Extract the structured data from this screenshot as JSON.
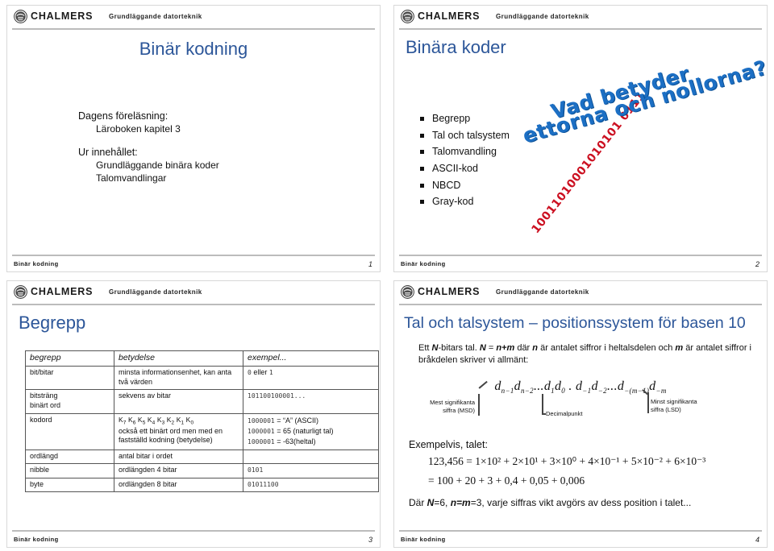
{
  "brand": {
    "name": "CHALMERS",
    "course": "Grundläggande datorteknik",
    "title_color": "#2c5699",
    "watermark_blue": "#1c6fc4",
    "watermark_red": "#cc1122"
  },
  "footer": {
    "label": "Binär kodning"
  },
  "slides": [
    {
      "number": "1",
      "title": "Binär kodning",
      "body": {
        "line1": "Dagens föreläsning:",
        "line2": "Läroboken kapitel 3",
        "line3": "Ur innehållet:",
        "line4": "Grundläggande binära koder",
        "line5": "Talomvandlingar"
      }
    },
    {
      "number": "2",
      "title": "Binära koder",
      "bullets": [
        "Begrepp",
        "Tal och talsystem",
        "Talomvandling",
        "ASCII-kod",
        "NBCD",
        "Gray-kod"
      ],
      "watermark": {
        "blue_line1": "Vad betyder",
        "blue_line2": "ettorna och nollorna?",
        "red_binary": "10011010001010101 0111"
      }
    },
    {
      "number": "3",
      "title": "Begrepp",
      "table": {
        "headers": [
          "begrepp",
          "betydelse",
          "exempel..."
        ],
        "rows": [
          {
            "begrepp": "bit/bitar",
            "betydelse": "minsta informationsenhet, kan anta två värden",
            "exempel_mono_a": "0",
            "exempel_plain": " eller ",
            "exempel_mono_b": "1"
          },
          {
            "begrepp": "bitsträng\nbinärt ord",
            "betydelse": "sekvens av bitar",
            "exempel_mono_a": "101100100001..."
          },
          {
            "begrepp": "kodord",
            "kword": "K7 K6 K5 K4 K3 K2 K1 K0",
            "betydelse": "också ett binärt ord men med en fastställd kodning (betydelse)",
            "exempel_lines": [
              {
                "bits": "1000001",
                "rest": " = “A” (ASCII)"
              },
              {
                "bits": "1000001",
                "rest": " = 65 (naturligt tal)"
              },
              {
                "bits": "1000001",
                "rest": " = -63(heltal)"
              }
            ]
          },
          {
            "begrepp": "ordlängd",
            "betydelse": "antal bitar i ordet",
            "exempel_mono_a": ""
          },
          {
            "begrepp": "nibble",
            "betydelse": "ordlängden 4 bitar",
            "exempel_mono_a": "0101"
          },
          {
            "begrepp": "byte",
            "betydelse": "ordlängden 8 bitar",
            "exempel_mono_a": "01011100"
          }
        ]
      }
    },
    {
      "number": "4",
      "title": "Tal och talsystem – positionssystem för basen 10",
      "paragraph_a": "Ett ",
      "paragraph_N1": "N",
      "paragraph_b": "-bitars tal. ",
      "paragraph_N2": "N",
      "paragraph_c": " = ",
      "paragraph_nm": "n+m",
      "paragraph_d": " där ",
      "paragraph_n": "n",
      "paragraph_e": " är antalet siffror i heltalsdelen och ",
      "paragraph_m": "m",
      "paragraph_f": " är antalet siffror i bråkdelen skriver vi allmänt:",
      "formula": "d n−1 d n−2 … d 1 d 0 . d −1 d −2 … d −(m−1) d −m",
      "annotations": {
        "msd": "Mest signifikanta\nsiffra (MSD)",
        "decimal": "Decimalpunkt",
        "lsd": "Minst signifikanta\nsiffra (LSD)"
      },
      "example_label": "Exempelvis, talet:",
      "equation_1": "123,456  = 1×10² + 2×10¹ + 3×10⁰ + 4×10⁻¹ + 5×10⁻² + 6×10⁻³",
      "equation_2": "= 100 + 20 + 3 + 0,4 + 0,05 + 0,006",
      "tail_a": "Där ",
      "tail_N": "N",
      "tail_b": "=6, ",
      "tail_nm": "n=m",
      "tail_c": "=3, varje siffras vikt avgörs av dess position i talet..."
    }
  ]
}
